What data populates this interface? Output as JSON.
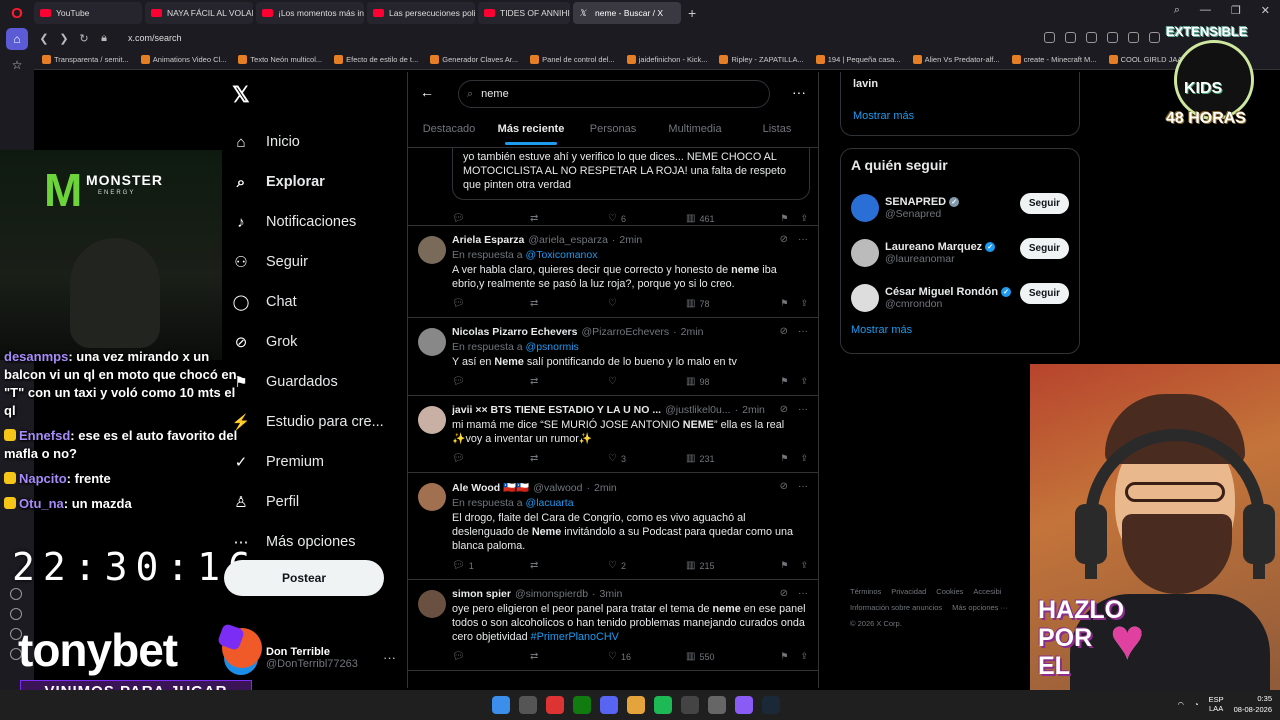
{
  "browser": {
    "tabs": [
      {
        "label": "YouTube",
        "icon": "youtube-icon"
      },
      {
        "label": "NAYA FÁCIL AL VOLANTE",
        "icon": "youtube-icon"
      },
      {
        "label": "¡Los momentos más incre",
        "icon": "youtube-icon"
      },
      {
        "label": "Las persecuciones policial",
        "icon": "youtube-icon"
      },
      {
        "label": "TIDES OF ANNIHILATION",
        "icon": "youtube-icon"
      },
      {
        "label": "neme - Buscar / X",
        "icon": "x-icon",
        "active": true
      }
    ],
    "url": "x.com/search",
    "bookmarks": [
      "Transparenta / semit...",
      "Animations Video Cl...",
      "Texto Neón multicol...",
      "Efecto de estilo de t...",
      "Generador Claves Ar...",
      "Panel de control del...",
      "jaidefinichon - Kick...",
      "Ripley - ZAPATILLA...",
      "194 | Pequeña casa...",
      "Alien Vs Predator-alf...",
      "create - Minecraft M...",
      "COOL GIRLD JAAJ |..."
    ]
  },
  "xnav": {
    "items": [
      {
        "label": "Inicio",
        "icon": "home-icon"
      },
      {
        "label": "Explorar",
        "icon": "search-icon",
        "bold": true
      },
      {
        "label": "Notificaciones",
        "icon": "bell-icon"
      },
      {
        "label": "Seguir",
        "icon": "follow-icon"
      },
      {
        "label": "Chat",
        "icon": "chat-icon"
      },
      {
        "label": "Grok",
        "icon": "grok-icon"
      },
      {
        "label": "Guardados",
        "icon": "bookmark-icon"
      },
      {
        "label": "Estudio para cre...",
        "icon": "studio-icon"
      },
      {
        "label": "Premium",
        "icon": "premium-icon"
      },
      {
        "label": "Perfil",
        "icon": "profile-icon"
      },
      {
        "label": "Más opciones",
        "icon": "more-icon"
      }
    ],
    "post_label": "Postear",
    "account": {
      "name": "Don Terrible",
      "handle": "@DonTerribl77263"
    }
  },
  "search": {
    "value": "neme",
    "tabs": [
      "Destacado",
      "Más reciente",
      "Personas",
      "Multimedia",
      "Listas"
    ],
    "active_tab": "Más reciente"
  },
  "posts": [
    {
      "text": "yo también estuve ahí y verifico lo que dices... NEME CHOCO AL MOTOCICLISTA AL NO RESPETAR LA ROJA! una falta de respeto que pinten otra verdad",
      "replies": "",
      "reposts": "",
      "likes": "6",
      "views": "461"
    },
    {
      "name": "Ariela Esparza",
      "handle": "@ariela_esparza",
      "time": "2min",
      "reply_to": "@Toxicomanox",
      "text_pre": "A ver habla claro, quieres decir que correcto y honesto de ",
      "text_bold": "neme",
      "text_post": " iba ebrio,y realmente se pasó la luz roja?, porque yo si lo creo.",
      "replies": "",
      "reposts": "",
      "likes": "",
      "views": "78"
    },
    {
      "name": "Nicolas Pizarro Echevers",
      "handle": "@PizarroEchevers",
      "time": "2min",
      "reply_to": "@psnormis",
      "text_pre": "Y así en ",
      "text_bold": "Neme",
      "text_post": " salí pontificando de lo bueno y lo malo en tv",
      "replies": "",
      "reposts": "",
      "likes": "",
      "views": "98"
    },
    {
      "name": "javii ×× BTS TIENE ESTADIO Y LA U NO ...",
      "handle": "@justlikel0u...",
      "time": "2min",
      "text_pre": "mi mamá me dice “SE MURIÓ JOSE ANTONIO ",
      "text_bold": "NEME",
      "text_post": "” ella es la real ✨voy a inventar un rumor✨",
      "replies": "",
      "reposts": "",
      "likes": "3",
      "views": "231"
    },
    {
      "name": "Ale Wood 🇨🇱🇨🇱",
      "handle": "@valwood",
      "time": "2min",
      "reply_to": "@lacuarta",
      "text_pre": "El drogo, flaite del Cara de Congrio, como es vivo aguachó al deslenguado de ",
      "text_bold": "Neme",
      "text_post": " invitándolo a su Podcast para quedar como una blanca paloma.",
      "replies": "1",
      "reposts": "",
      "likes": "2",
      "views": "215"
    },
    {
      "name": "simon spier",
      "handle": "@simonspierdb",
      "time": "3min",
      "text_pre": "oye pero eligieron el peor panel para tratar el tema de ",
      "text_bold": "neme",
      "text_post": " en ese panel todos o son alcoholicos o han tenido problemas manejando curados onda cero objetividad ",
      "hashtag": "#PrimerPlanoCHV",
      "replies": "",
      "reposts": "",
      "likes": "16",
      "views": "550"
    }
  ],
  "right": {
    "trend_top": "lavin",
    "show_more": "Mostrar más",
    "follow_title": "A quién seguir",
    "follow": [
      {
        "name": "SENAPRED",
        "handle": "@Senapred",
        "verified": "gray",
        "button": "Seguir"
      },
      {
        "name": "Laureano Marquez",
        "handle": "@laureanomar",
        "verified": "blue",
        "button": "Seguir"
      },
      {
        "name": "César Miguel Rondón",
        "handle": "@cmrondon",
        "verified": "blue",
        "button": "Seguir"
      }
    ],
    "show_more_2": "Mostrar más",
    "footer": [
      "Términos",
      "Privacidad",
      "Cookies",
      "Accesibi",
      "Información sobre anuncios",
      "Más opciones ···",
      "© 2026 X Corp."
    ]
  },
  "overlay": {
    "chat": [
      {
        "user": "desanmps",
        "msg": ": una vez mirando x un balcon vi un ql en moto que chocó en \"T\" con un taxi y voló como 10 mts el ql"
      },
      {
        "user": "Ennefsd",
        "msg": ": ese es el auto favorito del mafla o no?"
      },
      {
        "user": "Napcito",
        "msg": ": frente"
      },
      {
        "user": "Otu_na",
        "msg": ": un mazda"
      }
    ],
    "clock": "22:30:16",
    "sponsor": "tonybet",
    "sponsor_tagline": "VINIMOS PARA JUGAR",
    "monster": "MONSTER",
    "monster_sub": "ENERGY",
    "kids_top": "EXTENSIBLE",
    "kids_mid": "KIDS",
    "kids_bottom": "48 HORAS",
    "hazlo": "HAZLO POR EL"
  },
  "taskbar": {
    "lang1": "ESP",
    "lang2": "LAA",
    "time": "0:35",
    "date": "08-08-2026"
  },
  "colors": {
    "accent": "#1d9bf0",
    "bg": "#000000",
    "border": "#2f3336"
  }
}
